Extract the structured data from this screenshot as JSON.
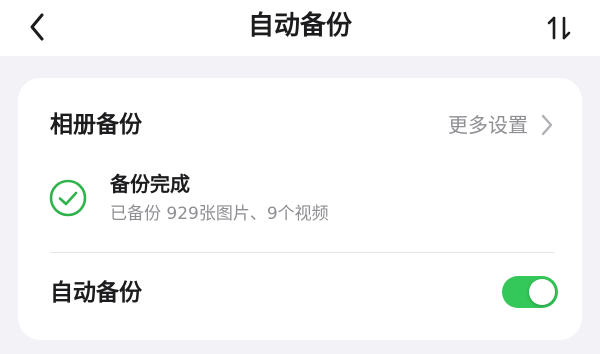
{
  "header": {
    "title": "自动备份",
    "back_icon": "chevron-left-icon",
    "sort_icon": "sort-arrows-icon"
  },
  "album_backup": {
    "title": "相册备份",
    "more_settings_label": "更多设置",
    "more_settings_icon": "chevron-right-icon"
  },
  "backup_status": {
    "icon": "check-circle-icon",
    "title": "备份完成",
    "detail": "已备份 929张图片、9个视频"
  },
  "auto_backup": {
    "label": "自动备份",
    "enabled": true
  },
  "colors": {
    "accent_green": "#34c759",
    "check_green": "#2fb34d",
    "background": "#f2f2f7",
    "secondary_text": "#8e8e93"
  }
}
